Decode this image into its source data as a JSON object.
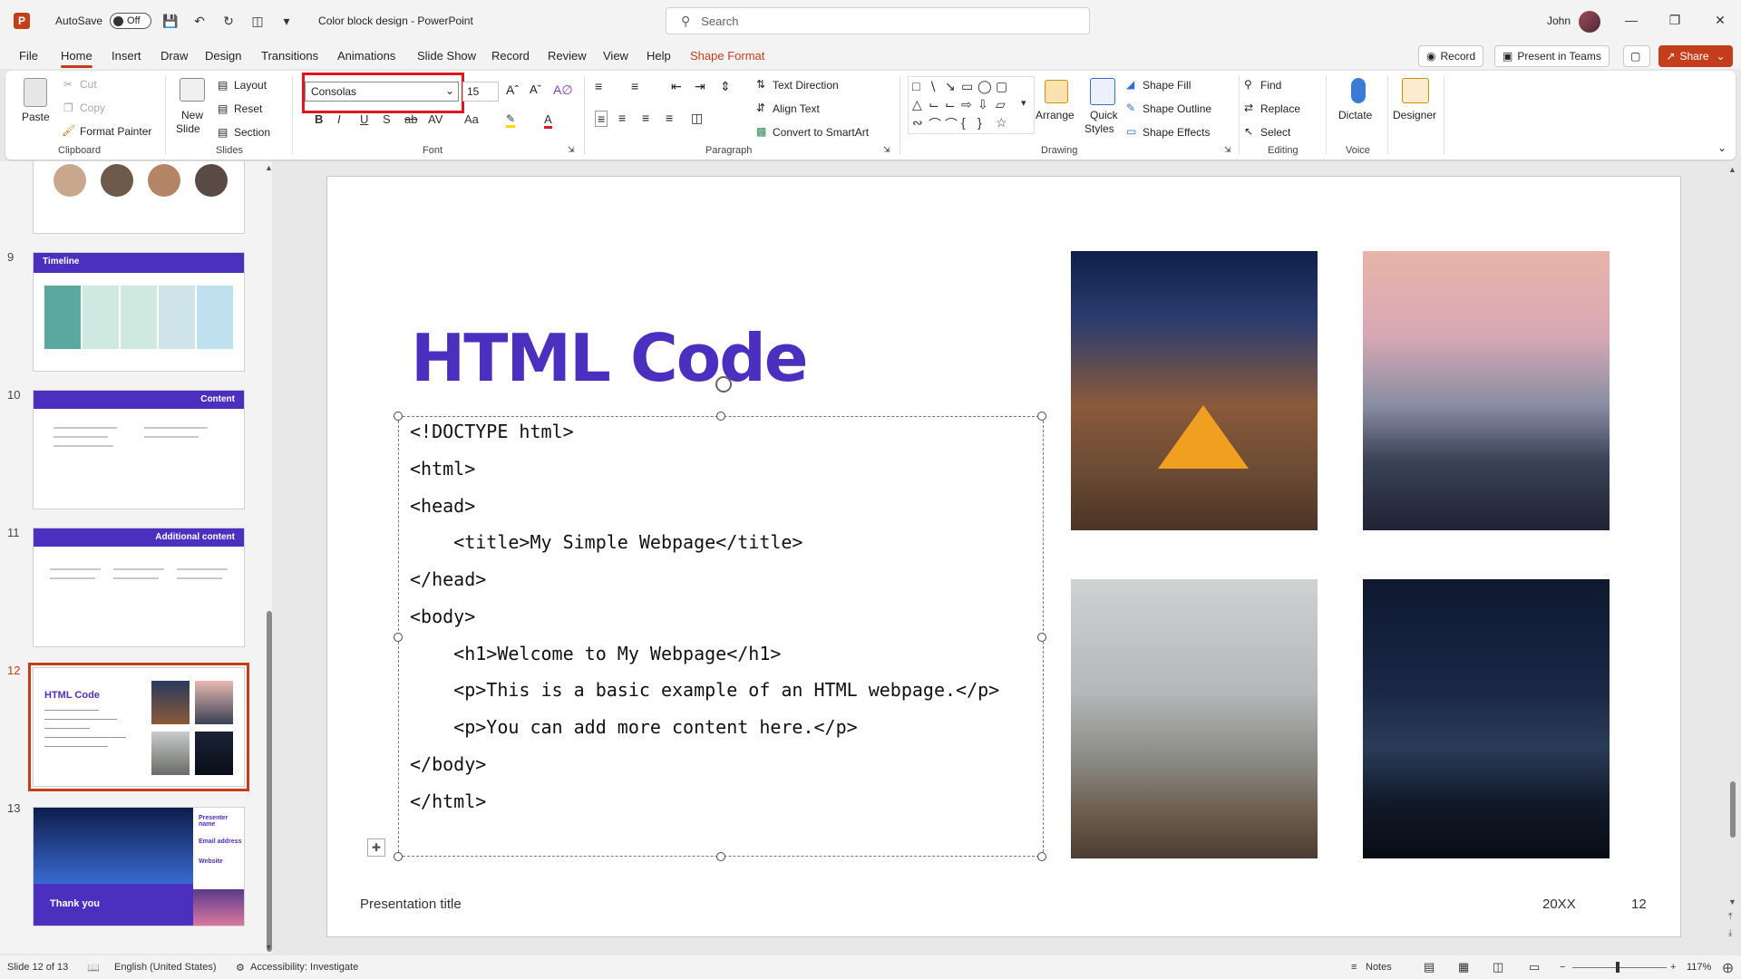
{
  "titlebar": {
    "autosave_label": "AutoSave",
    "autosave_state": "Off",
    "doc_title": "Color block design - PowerPoint",
    "search_placeholder": "Search",
    "user_name": "John"
  },
  "menu": {
    "tabs": [
      "File",
      "Home",
      "Insert",
      "Draw",
      "Design",
      "Transitions",
      "Animations",
      "Slide Show",
      "Record",
      "Review",
      "View",
      "Help",
      "Shape Format"
    ],
    "active_tab": "Home",
    "record_button": "Record",
    "present_teams_button": "Present in Teams",
    "share_button": "Share"
  },
  "ribbon": {
    "clipboard": {
      "paste": "Paste",
      "cut": "Cut",
      "copy": "Copy",
      "format_painter": "Format Painter",
      "label": "Clipboard"
    },
    "slides": {
      "new_slide_line1": "New",
      "new_slide_line2": "Slide",
      "layout": "Layout",
      "reset": "Reset",
      "section": "Section",
      "label": "Slides"
    },
    "font": {
      "font_name": "Consolas",
      "font_size": "15",
      "label": "Font"
    },
    "paragraph": {
      "text_direction": "Text Direction",
      "align_text": "Align Text",
      "convert_smartart": "Convert to SmartArt",
      "label": "Paragraph"
    },
    "drawing": {
      "arrange": "Arrange",
      "quick_styles_line1": "Quick",
      "quick_styles_line2": "Styles",
      "shape_fill": "Shape Fill",
      "shape_outline": "Shape Outline",
      "shape_effects": "Shape Effects",
      "label": "Drawing"
    },
    "editing": {
      "find": "Find",
      "replace": "Replace",
      "select": "Select",
      "label": "Editing"
    },
    "voice": {
      "dictate": "Dictate",
      "label": "Voice"
    },
    "designer": {
      "designer": "Designer"
    }
  },
  "thumbnails": {
    "items": [
      {
        "num": "9",
        "title": "Timeline"
      },
      {
        "num": "10",
        "title": "Content"
      },
      {
        "num": "11",
        "title": "Additional content"
      },
      {
        "num": "12",
        "title": "HTML Code"
      },
      {
        "num": "13",
        "title": "Thank you",
        "sub1": "Presenter name",
        "sub2": "Email address",
        "sub3": "Website"
      }
    ]
  },
  "slide": {
    "title": "HTML Code",
    "code_lines": [
      "<!DOCTYPE html>",
      "<html>",
      "<head>",
      "    <title>My Simple Webpage</title>",
      "</head>",
      "<body>",
      "    <h1>Welcome to My Webpage</h1>",
      "    <p>This is a basic example of an HTML webpage.</p>",
      "    <p>You can add more content here.</p>",
      "</body>",
      "</html>"
    ],
    "footer_left": "Presentation title",
    "footer_date": "20XX",
    "footer_page": "12"
  },
  "statusbar": {
    "slide_info": "Slide 12 of 13",
    "language": "English (United States)",
    "accessibility": "Accessibility: Investigate",
    "notes": "Notes",
    "zoom": "117%"
  },
  "colors": {
    "accent": "#c43e1c",
    "title_purple": "#4b2fbf",
    "highlight_red": "#e0161e"
  }
}
